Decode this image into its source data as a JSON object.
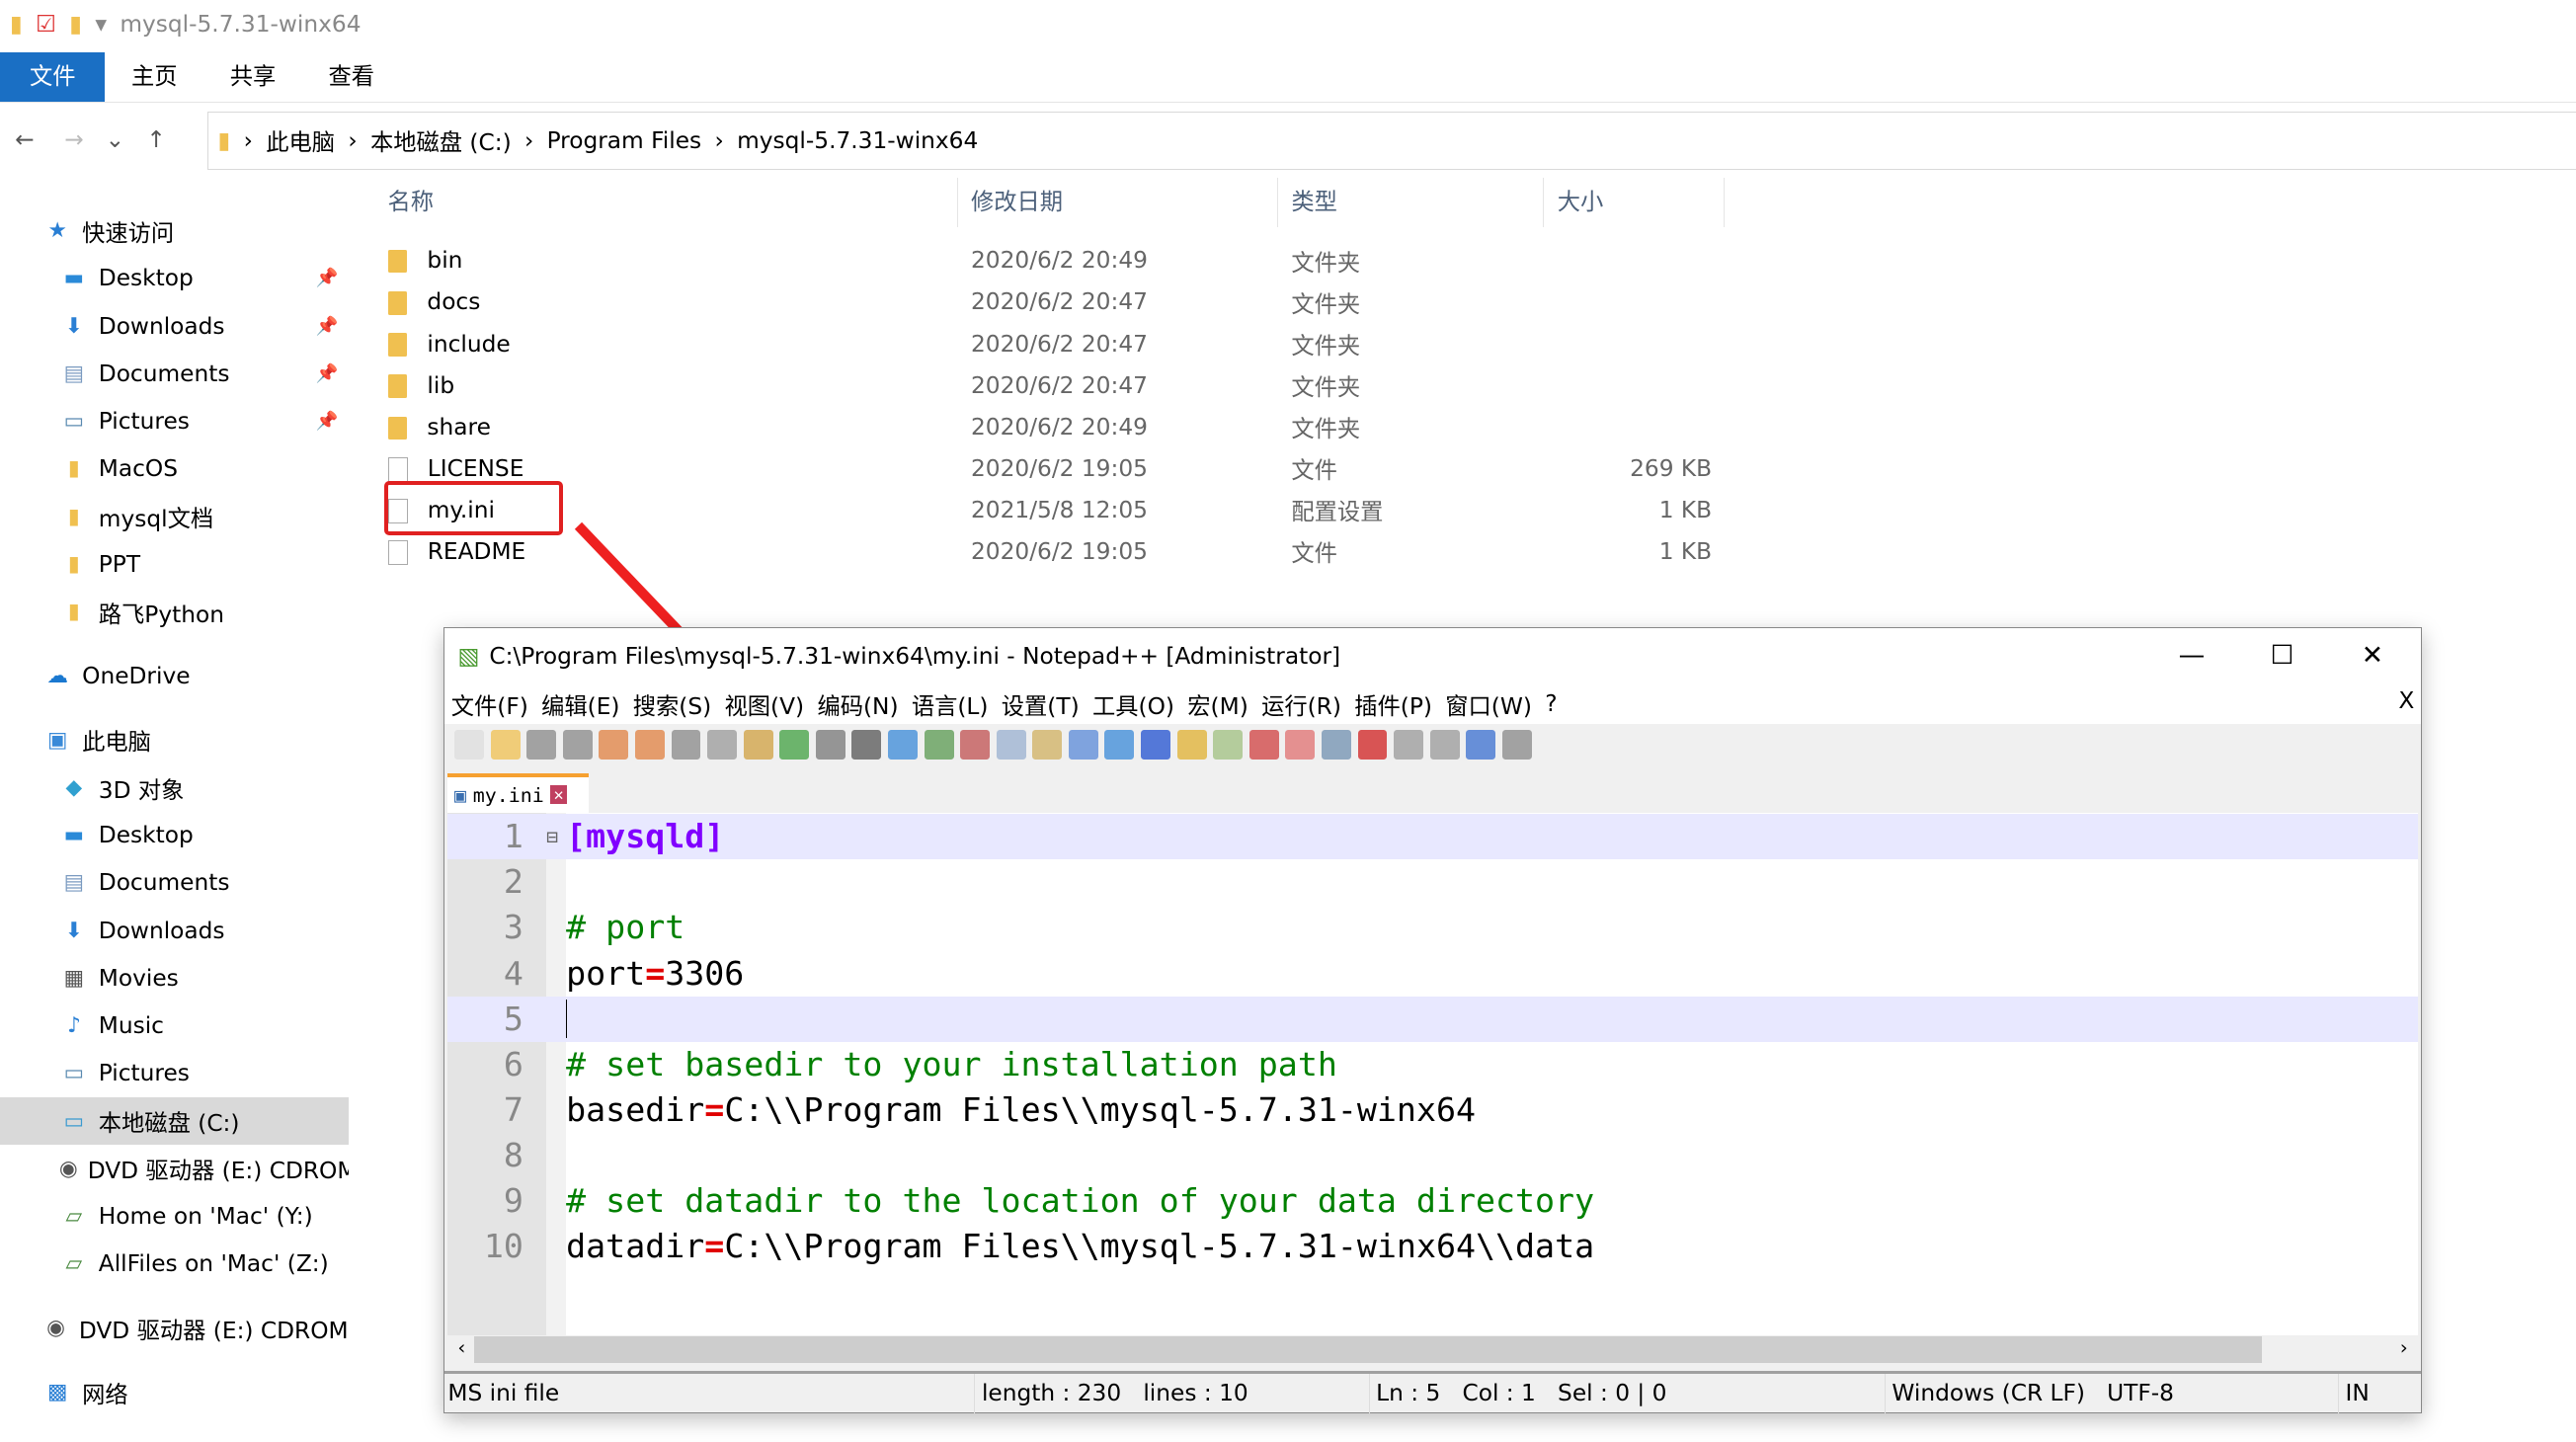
{
  "window": {
    "title": "mysql-5.7.31-winx64"
  },
  "ribbon": {
    "tabs": [
      "文件",
      "主页",
      "共享",
      "查看"
    ]
  },
  "address": {
    "crumbs": [
      "此电脑",
      "本地磁盘 (C:)",
      "Program Files",
      "mysql-5.7.31-winx64"
    ]
  },
  "sidebar": {
    "items": [
      {
        "label": "快速访问",
        "icon": "star-icon",
        "indent": 0
      },
      {
        "label": "Desktop",
        "icon": "desktop-icon",
        "indent": 1,
        "pinned": true
      },
      {
        "label": "Downloads",
        "icon": "download-icon",
        "indent": 1,
        "pinned": true
      },
      {
        "label": "Documents",
        "icon": "document-icon",
        "indent": 1,
        "pinned": true
      },
      {
        "label": "Pictures",
        "icon": "pictures-icon",
        "indent": 1,
        "pinned": true
      },
      {
        "label": "MacOS",
        "icon": "folder-icon",
        "indent": 1
      },
      {
        "label": "mysql文档",
        "icon": "folder-icon",
        "indent": 1
      },
      {
        "label": "PPT",
        "icon": "folder-icon",
        "indent": 1
      },
      {
        "label": "路飞Python",
        "icon": "folder-icon",
        "indent": 1
      },
      {
        "label": "OneDrive",
        "icon": "cloud-icon",
        "indent": 0
      },
      {
        "label": "此电脑",
        "icon": "computer-icon",
        "indent": 0
      },
      {
        "label": "3D 对象",
        "icon": "cube-icon",
        "indent": 1
      },
      {
        "label": "Desktop",
        "icon": "desktop-icon",
        "indent": 1
      },
      {
        "label": "Documents",
        "icon": "document-icon",
        "indent": 1
      },
      {
        "label": "Downloads",
        "icon": "download-icon",
        "indent": 1
      },
      {
        "label": "Movies",
        "icon": "film-icon",
        "indent": 1
      },
      {
        "label": "Music",
        "icon": "music-icon",
        "indent": 1
      },
      {
        "label": "Pictures",
        "icon": "pictures-icon",
        "indent": 1
      },
      {
        "label": "本地磁盘 (C:)",
        "icon": "drive-icon",
        "indent": 1,
        "selected": true
      },
      {
        "label": "DVD 驱动器 (E:) CDROM",
        "icon": "dvd-icon",
        "indent": 1
      },
      {
        "label": "Home on 'Mac' (Y:)",
        "icon": "network-drive-icon",
        "indent": 1
      },
      {
        "label": "AllFiles on 'Mac' (Z:)",
        "icon": "network-drive-icon",
        "indent": 1
      },
      {
        "label": "DVD 驱动器 (E:) CDROM",
        "icon": "dvd-icon",
        "indent": 0
      },
      {
        "label": "网络",
        "icon": "network-icon",
        "indent": 0
      }
    ]
  },
  "files": {
    "headers": [
      "名称",
      "修改日期",
      "类型",
      "大小"
    ],
    "rows": [
      {
        "name": "bin",
        "date": "2020/6/2 20:49",
        "type": "文件夹",
        "size": "",
        "folder": true
      },
      {
        "name": "docs",
        "date": "2020/6/2 20:47",
        "type": "文件夹",
        "size": "",
        "folder": true
      },
      {
        "name": "include",
        "date": "2020/6/2 20:47",
        "type": "文件夹",
        "size": "",
        "folder": true
      },
      {
        "name": "lib",
        "date": "2020/6/2 20:47",
        "type": "文件夹",
        "size": "",
        "folder": true
      },
      {
        "name": "share",
        "date": "2020/6/2 20:49",
        "type": "文件夹",
        "size": "",
        "folder": true
      },
      {
        "name": "LICENSE",
        "date": "2020/6/2 19:05",
        "type": "文件",
        "size": "269 KB",
        "folder": false
      },
      {
        "name": "my.ini",
        "date": "2021/5/8 12:05",
        "type": "配置设置",
        "size": "1 KB",
        "folder": false
      },
      {
        "name": "README",
        "date": "2020/6/2 19:05",
        "type": "文件",
        "size": "1 KB",
        "folder": false
      }
    ]
  },
  "notepad": {
    "title": "C:\\Program Files\\mysql-5.7.31-winx64\\my.ini - Notepad++ [Administrator]",
    "menu": [
      "文件(F)",
      "编辑(E)",
      "搜索(S)",
      "视图(V)",
      "编码(N)",
      "语言(L)",
      "设置(T)",
      "工具(O)",
      "宏(M)",
      "运行(R)",
      "插件(P)",
      "窗口(W)",
      "?"
    ],
    "menu_close": "X",
    "tab": "my.ini",
    "lines": [
      {
        "n": "1",
        "parts": [
          {
            "c": "sec",
            "t": "[mysqld]"
          }
        ]
      },
      {
        "n": "2",
        "parts": []
      },
      {
        "n": "3",
        "parts": [
          {
            "c": "cm",
            "t": "# port"
          }
        ]
      },
      {
        "n": "4",
        "parts": [
          {
            "c": "",
            "t": "port"
          },
          {
            "c": "eq",
            "t": "="
          },
          {
            "c": "",
            "t": "3306"
          }
        ]
      },
      {
        "n": "5",
        "parts": []
      },
      {
        "n": "6",
        "parts": [
          {
            "c": "cm",
            "t": "# set basedir to your installation path"
          }
        ]
      },
      {
        "n": "7",
        "parts": [
          {
            "c": "",
            "t": "basedir"
          },
          {
            "c": "eq",
            "t": "="
          },
          {
            "c": "",
            "t": "C:\\\\Program Files\\\\mysql-5.7.31-winx64"
          }
        ]
      },
      {
        "n": "8",
        "parts": []
      },
      {
        "n": "9",
        "parts": [
          {
            "c": "cm",
            "t": "# set datadir to the location of your data directory"
          }
        ]
      },
      {
        "n": "10",
        "parts": [
          {
            "c": "",
            "t": "datadir"
          },
          {
            "c": "eq",
            "t": "="
          },
          {
            "c": "",
            "t": "C:\\\\Program Files\\\\mysql-5.7.31-winx64\\\\data"
          }
        ]
      }
    ],
    "status": {
      "type": "MS ini file",
      "length": "length : 230",
      "lines": "lines : 10",
      "ln": "Ln : 5",
      "col": "Col : 1",
      "sel": "Sel : 0 | 0",
      "eol": "Windows (CR LF)",
      "enc": "UTF-8",
      "mode": "IN"
    }
  },
  "colors": {
    "accent": "#1a6fc4",
    "annotation": "#e02020"
  }
}
